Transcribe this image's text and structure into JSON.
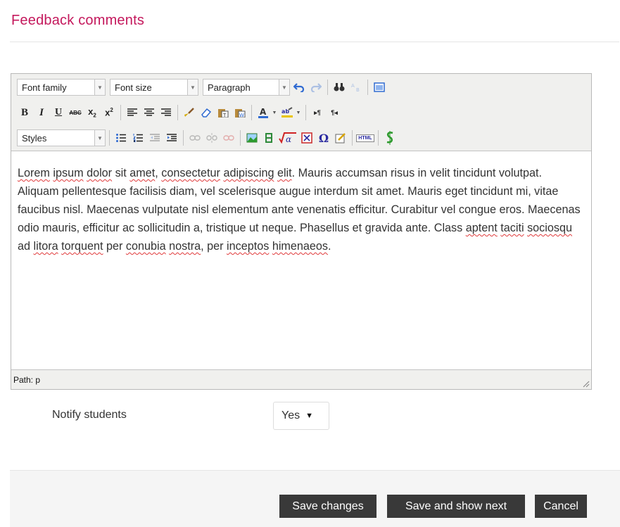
{
  "section": {
    "title": "Feedback comments"
  },
  "editor": {
    "toolbar": {
      "font_family": "Font family",
      "font_size": "Font size",
      "format": "Paragraph",
      "styles": "Styles",
      "html_button": "HTML"
    },
    "content": {
      "paragraph": [
        {
          "t": "Lorem",
          "spell": true
        },
        {
          "t": " "
        },
        {
          "t": "ipsum",
          "spell": true
        },
        {
          "t": " "
        },
        {
          "t": "dolor",
          "spell": true
        },
        {
          "t": " sit "
        },
        {
          "t": "amet",
          "spell": true
        },
        {
          "t": ", "
        },
        {
          "t": "consectetur",
          "spell": true
        },
        {
          "t": " "
        },
        {
          "t": "adipiscing",
          "spell": true
        },
        {
          "t": " "
        },
        {
          "t": "elit",
          "spell": true
        },
        {
          "t": ". Mauris accumsan risus in velit tincidunt volutpat. Aliquam pellentesque facilisis diam, vel scelerisque augue interdum sit amet. Mauris eget tincidunt mi, vitae faucibus nisl. Maecenas vulputate nisl elementum ante venenatis efficitur. Curabitur vel congue eros. Maecenas odio mauris, efficitur ac sollicitudin a, tristique ut neque. Phasellus et gravida ante. Class "
        },
        {
          "t": "aptent",
          "spell": true
        },
        {
          "t": " "
        },
        {
          "t": "taciti",
          "spell": true
        },
        {
          "t": " "
        },
        {
          "t": "sociosqu",
          "spell": true
        },
        {
          "t": " ad "
        },
        {
          "t": "litora",
          "spell": true
        },
        {
          "t": " "
        },
        {
          "t": "torquent",
          "spell": true
        },
        {
          "t": " per "
        },
        {
          "t": "conubia",
          "spell": true
        },
        {
          "t": " "
        },
        {
          "t": "nostra",
          "spell": true
        },
        {
          "t": ", per "
        },
        {
          "t": "inceptos",
          "spell": true
        },
        {
          "t": " "
        },
        {
          "t": "himenaeos",
          "spell": true
        },
        {
          "t": "."
        }
      ]
    },
    "status_path": "Path: p"
  },
  "notify": {
    "label": "Notify students",
    "value": "Yes"
  },
  "actions": {
    "save_changes": "Save changes",
    "save_and_show_next": "Save and show next",
    "cancel": "Cancel"
  },
  "colors": {
    "heading": "#c4185c",
    "button_bg": "#393939",
    "spellcheck": "#e0393a"
  }
}
